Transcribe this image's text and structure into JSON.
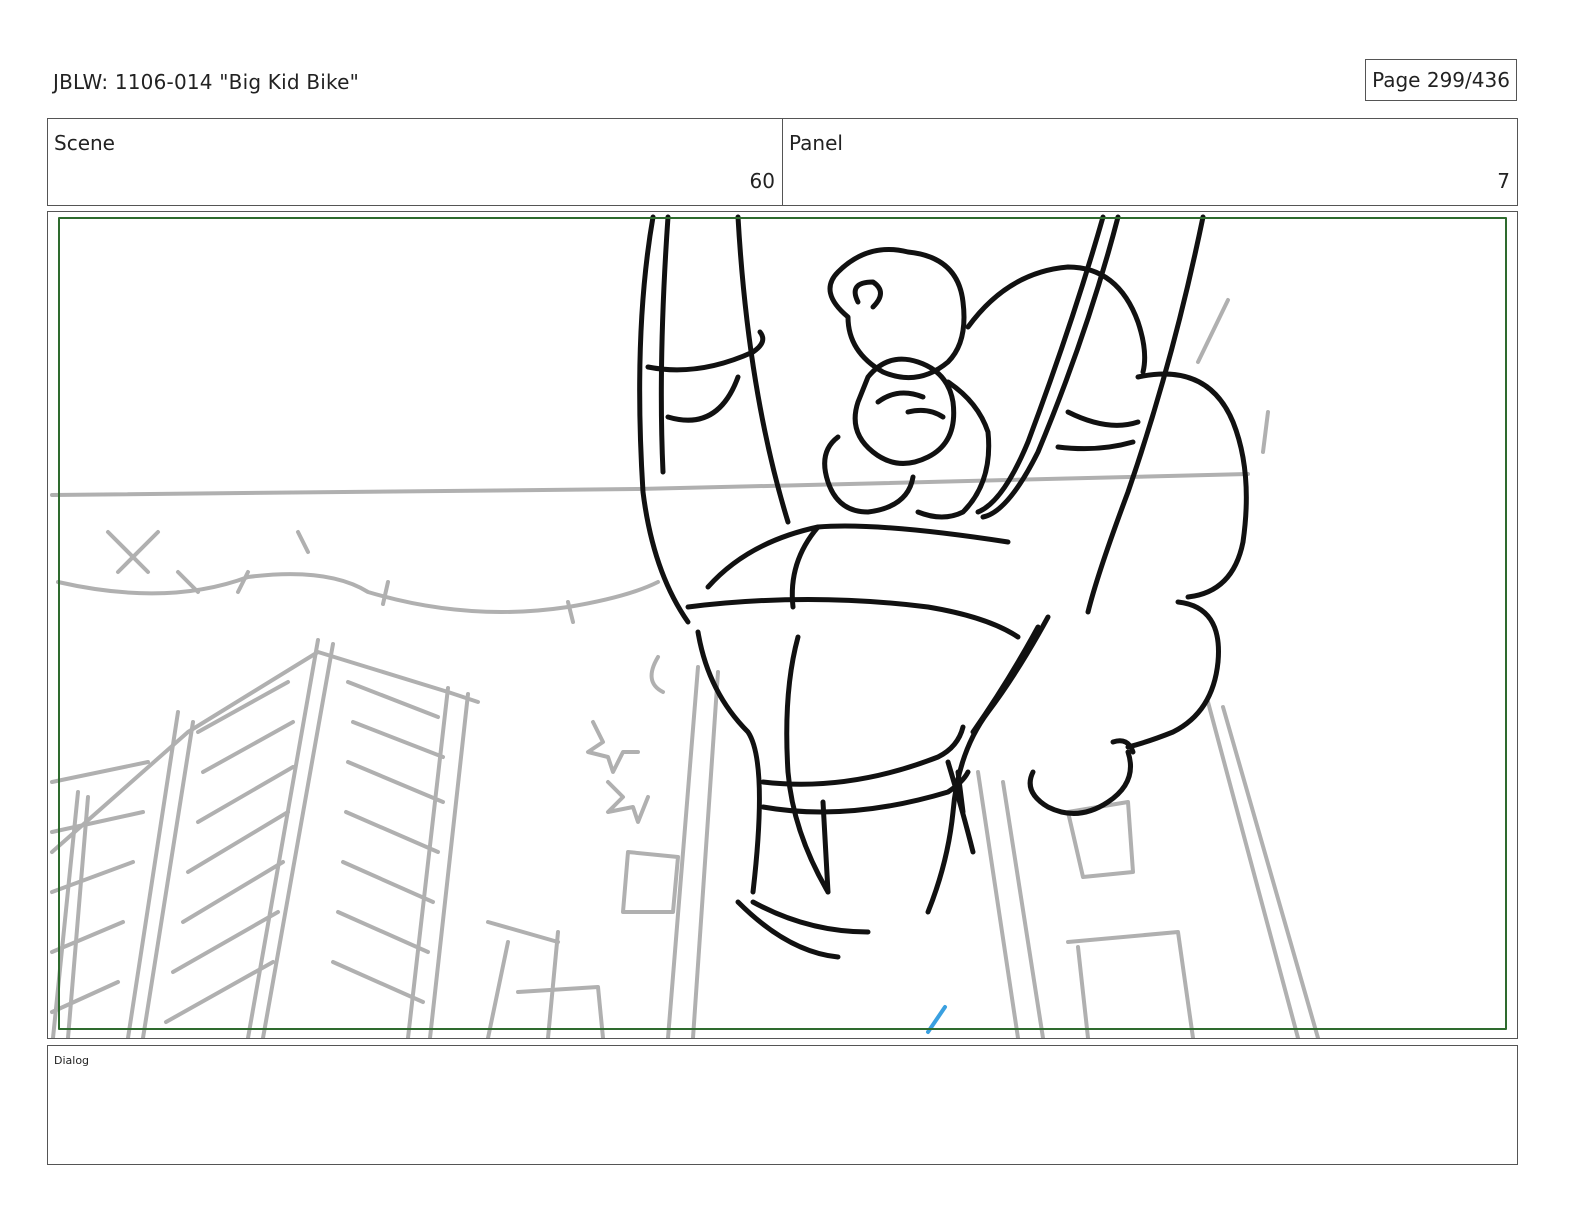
{
  "header": {
    "title": "JBLW: 1106-014 \"Big Kid Bike\"",
    "page": "Page 299/436"
  },
  "scene": {
    "label": "Scene",
    "value": "60"
  },
  "panel": {
    "label": "Panel",
    "value": "7"
  },
  "dialog": {
    "label": "Dialog",
    "text": ""
  },
  "colors": {
    "safe_frame": "#2e6b2e",
    "sketch_black": "#111111",
    "sketch_grey": "#b0b0b0",
    "sketch_blue": "#3aa0e0"
  }
}
